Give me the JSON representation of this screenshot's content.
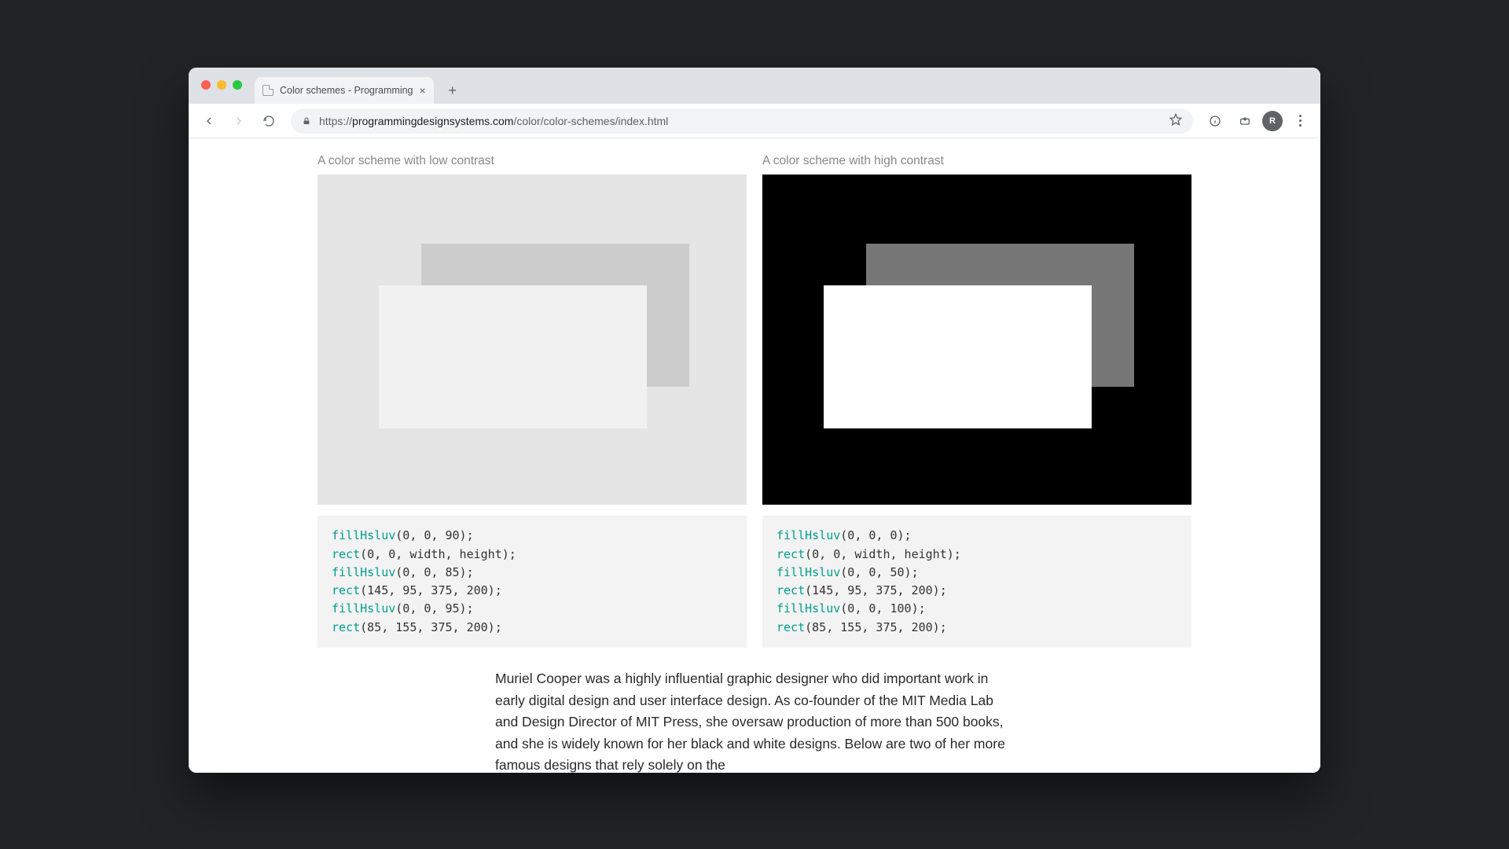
{
  "tab": {
    "title": "Color schemes - Programming"
  },
  "url": {
    "scheme": "https://",
    "host": "programmingdesignsystems.com",
    "path": "/color/color-schemes/index.html"
  },
  "avatar_initial": "R",
  "captions": {
    "low": "A color scheme with low contrast",
    "high": "A color scheme with high contrast"
  },
  "code_low": {
    "l1_fn": "fillHsluv",
    "l1_args": "(0, 0, 90);",
    "l2_fn": "rect",
    "l2_args": "(0, 0, width, height);",
    "l3_fn": "fillHsluv",
    "l3_args": "(0, 0, 85);",
    "l4_fn": "rect",
    "l4_args": "(145, 95, 375, 200);",
    "l5_fn": "fillHsluv",
    "l5_args": "(0, 0, 95);",
    "l6_fn": "rect",
    "l6_args": "(85, 155, 375, 200);"
  },
  "code_high": {
    "l1_fn": "fillHsluv",
    "l1_args": "(0, 0, 0);",
    "l2_fn": "rect",
    "l2_args": "(0, 0, width, height);",
    "l3_fn": "fillHsluv",
    "l3_args": "(0, 0, 50);",
    "l4_fn": "rect",
    "l4_args": "(145, 95, 375, 200);",
    "l5_fn": "fillHsluv",
    "l5_args": "(0, 0, 100);",
    "l6_fn": "rect",
    "l6_args": "(85, 155, 375, 200);"
  },
  "body_paragraph": "Muriel Cooper was a highly influential graphic designer who did important work in early digital design and user interface design. As co-founder of the MIT Media Lab and Design Director of MIT Press, she oversaw production of more than 500 books, and she is widely known for her black and white designs. Below are two of her more famous designs that rely solely on the"
}
